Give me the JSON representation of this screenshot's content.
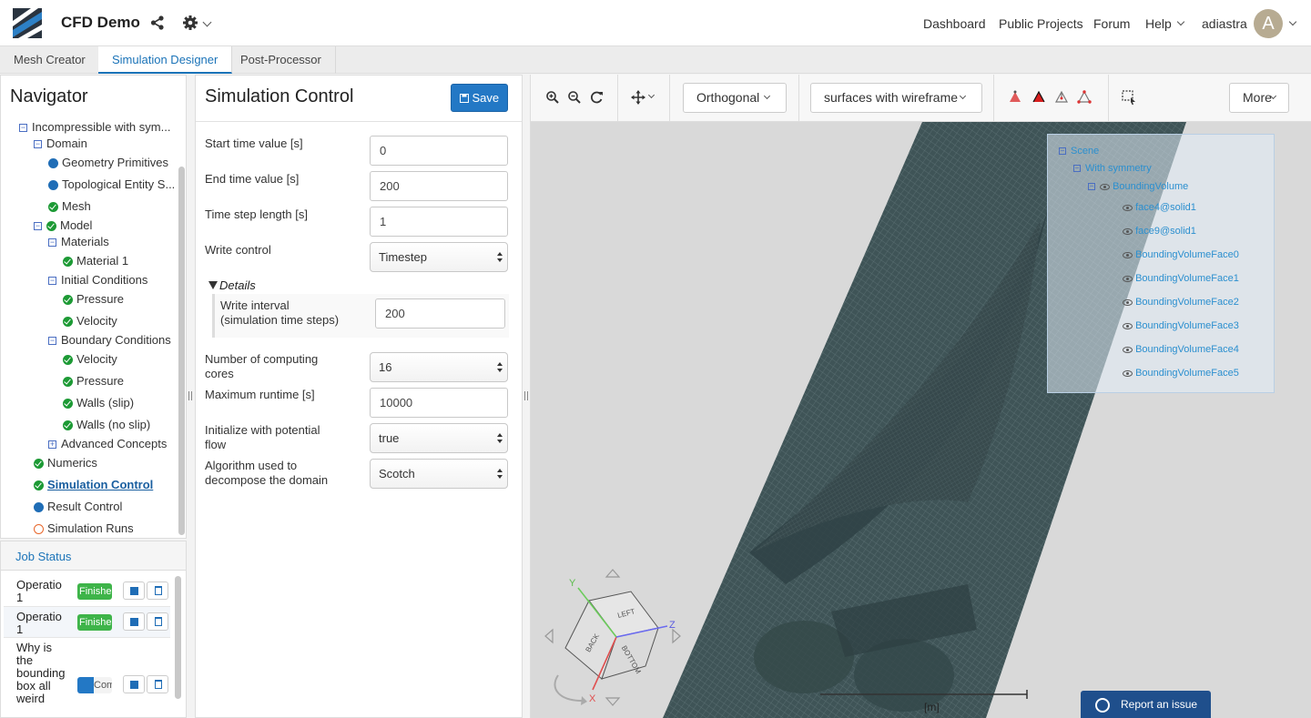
{
  "header": {
    "app_title": "CFD Demo",
    "nav": [
      "Dashboard",
      "Public Projects",
      "Forum",
      "Help"
    ],
    "username": "adiastra",
    "avatar_letter": "A"
  },
  "tabs": [
    {
      "label": "Mesh Creator",
      "active": false
    },
    {
      "label": "Simulation Designer",
      "active": true
    },
    {
      "label": "Post-Processor",
      "active": false
    }
  ],
  "navigator": {
    "title": "Navigator",
    "items": [
      "Incompressible with sym...",
      "Domain",
      "Geometry Primitives",
      "Topological Entity S...",
      "Mesh",
      "Model",
      "Materials",
      "Material 1",
      "Initial Conditions",
      "Pressure",
      "Velocity",
      "Boundary Conditions",
      "Velocity",
      "Pressure",
      "Walls (slip)",
      "Walls (no slip)",
      "Advanced Concepts",
      "Numerics",
      "Simulation Control",
      "Result Control",
      "Simulation Runs"
    ]
  },
  "jobs": {
    "title": "Job Status",
    "rows": [
      {
        "name": "Operatio 1",
        "status": "Finished"
      },
      {
        "name": "Operatio 1",
        "status": "Finished"
      },
      {
        "name": "Why is the bounding box all weird",
        "status": "Computing"
      }
    ]
  },
  "sim": {
    "title": "Simulation Control",
    "save_label": "Save",
    "details_label": "Details",
    "fields": {
      "start_label": "Start time value [s]",
      "start_value": "0",
      "end_label": "End time value [s]",
      "end_value": "200",
      "step_label": "Time step length [s]",
      "step_value": "1",
      "write_label": "Write control",
      "write_value": "Timestep",
      "interval_label": "Write interval (simulation time steps)",
      "interval_value": "200",
      "cores_label": "Number of computing cores",
      "cores_value": "16",
      "runtime_label": "Maximum runtime [s]",
      "runtime_value": "10000",
      "potential_label": "Initialize with potential flow",
      "potential_value": "true",
      "decomp_label": "Algorithm used to decompose the domain",
      "decomp_value": "Scotch"
    }
  },
  "viewer": {
    "projection": "Orthogonal",
    "render_mode": "surfaces with wireframe",
    "more_label": "More",
    "scene": {
      "root": "Scene",
      "group": "With symmetry",
      "volume": "BoundingVolume",
      "faces": [
        "face4@solid1",
        "face9@solid1",
        "BoundingVolumeFace0",
        "BoundingVolumeFace1",
        "BoundingVolumeFace2",
        "BoundingVolumeFace3",
        "BoundingVolumeFace4",
        "BoundingVolumeFace5"
      ]
    },
    "cube_labels": {
      "left": "LEFT",
      "back": "BACK",
      "bottom": "BOTTOM"
    },
    "axes": {
      "x": "X",
      "y": "Y",
      "z": "Z"
    },
    "scale_label": "[m]",
    "report_label": "Report an issue"
  },
  "colors": {
    "accent": "#1a73b8",
    "save": "#2378c5",
    "ok": "#1d9a35",
    "mesh": "#3d5356",
    "report": "#1f4f8c"
  }
}
